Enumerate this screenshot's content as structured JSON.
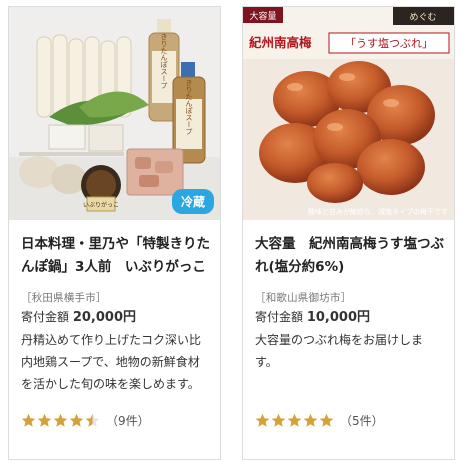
{
  "products": [
    {
      "badge": "冷蔵",
      "title": "日本料理・里乃や「特製きりたんぽ鍋」3人前　いぶりがっこ",
      "region": "［秋田県横手市］",
      "price_label": "寄付金額",
      "price_value": "20,000円",
      "description": "丹精込めて作り上げたコク深い比内地鶏スープで、地物の新鮮食材を活かした旬の味を楽しめます。",
      "rating": 4.5,
      "review_count": "（9件）",
      "image_text": {
        "bottle1": "きりたんぽスープ",
        "bottle2": "きりたんぽスープ",
        "bag": "いぶりがっこ"
      }
    },
    {
      "title": "大容量　紀州南高梅うす塩つぶれ(塩分約6%)",
      "region": "［和歌山県御坊市］",
      "price_label": "寄付金額",
      "price_value": "10,000円",
      "description": "大容量のつぶれ梅をお届けします。",
      "rating": 5,
      "review_count": "（5件）",
      "image_text": {
        "tag": "大容量",
        "headline_plain": "紀州南高梅",
        "headline_boxed": "「うす塩つぶれ」",
        "brand": "めぐむ",
        "caption": "酸味と甘みが絶妙な、減塩タイプの梅干です"
      }
    }
  ],
  "colors": {
    "star": "#d4a23c",
    "star_empty": "#e3e3e3",
    "badge_bg": "#2aa7e0",
    "plum_banner": "#7d1420",
    "plum_text": "#b3151f"
  }
}
